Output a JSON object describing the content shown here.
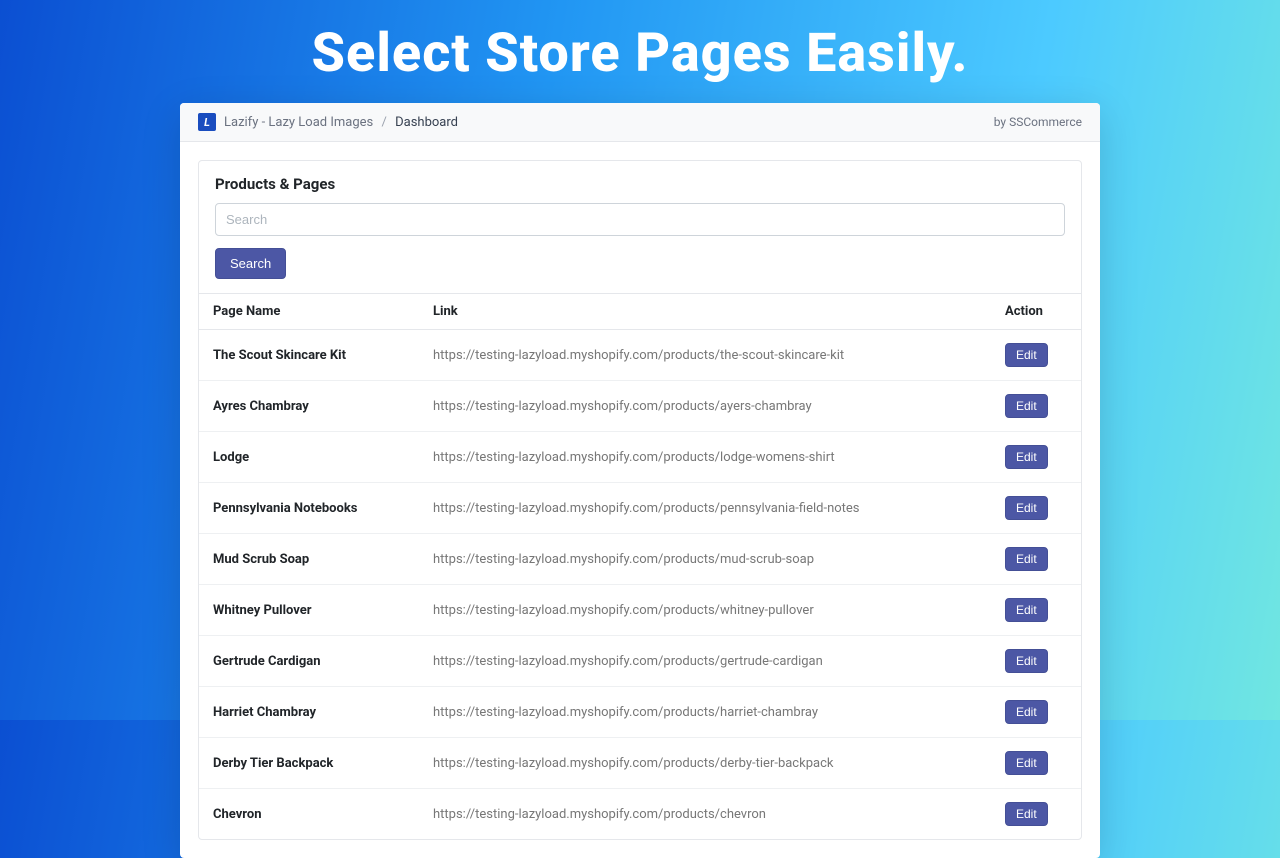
{
  "hero": {
    "title": "Select Store Pages Easily."
  },
  "header": {
    "app_name": "Lazify - Lazy Load Images",
    "separator": "/",
    "current": "Dashboard",
    "by_label": "by SSCommerce",
    "logo_letter": "L"
  },
  "panel": {
    "title": "Products & Pages",
    "search_placeholder": "Search",
    "search_button": "Search"
  },
  "table": {
    "columns": {
      "page_name": "Page Name",
      "link": "Link",
      "action": "Action"
    },
    "action_label": "Edit",
    "rows": [
      {
        "name": "The Scout Skincare Kit",
        "link": "https://testing-lazyload.myshopify.com/products/the-scout-skincare-kit"
      },
      {
        "name": "Ayres Chambray",
        "link": "https://testing-lazyload.myshopify.com/products/ayers-chambray"
      },
      {
        "name": "Lodge",
        "link": "https://testing-lazyload.myshopify.com/products/lodge-womens-shirt"
      },
      {
        "name": "Pennsylvania Notebooks",
        "link": "https://testing-lazyload.myshopify.com/products/pennsylvania-field-notes"
      },
      {
        "name": "Mud Scrub Soap",
        "link": "https://testing-lazyload.myshopify.com/products/mud-scrub-soap"
      },
      {
        "name": "Whitney Pullover",
        "link": "https://testing-lazyload.myshopify.com/products/whitney-pullover"
      },
      {
        "name": "Gertrude Cardigan",
        "link": "https://testing-lazyload.myshopify.com/products/gertrude-cardigan"
      },
      {
        "name": "Harriet Chambray",
        "link": "https://testing-lazyload.myshopify.com/products/harriet-chambray"
      },
      {
        "name": "Derby Tier Backpack",
        "link": "https://testing-lazyload.myshopify.com/products/derby-tier-backpack"
      },
      {
        "name": "Chevron",
        "link": "https://testing-lazyload.myshopify.com/products/chevron"
      }
    ]
  }
}
